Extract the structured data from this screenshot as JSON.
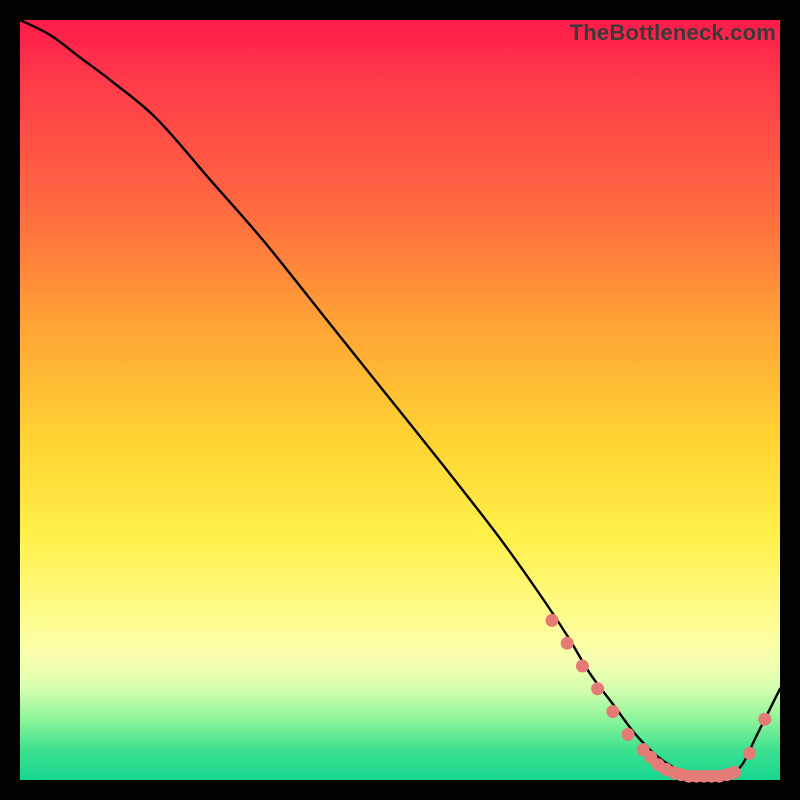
{
  "watermark": "TheBottleneck.com",
  "colors": {
    "curve": "#000000",
    "dot_fill": "#e47b76",
    "dot_stroke": "#c95a55"
  },
  "chart_data": {
    "type": "line",
    "title": "",
    "xlabel": "",
    "ylabel": "",
    "xlim": [
      0,
      100
    ],
    "ylim": [
      0,
      100
    ],
    "series": [
      {
        "name": "bottleneck-curve",
        "x": [
          0,
          4,
          8,
          12,
          18,
          25,
          32,
          40,
          48,
          56,
          63,
          68,
          72,
          75,
          78,
          81,
          84,
          87,
          90,
          93,
          95,
          97,
          100
        ],
        "y": [
          100,
          98,
          95,
          92,
          87,
          79,
          71,
          61,
          51,
          41,
          32,
          25,
          19,
          14,
          10,
          6,
          3,
          1.2,
          0.5,
          0.5,
          2,
          6,
          12
        ]
      }
    ],
    "dots": {
      "name": "highlight-dots",
      "x": [
        70,
        72,
        74,
        76,
        78,
        80,
        82,
        83,
        84,
        85,
        86,
        87,
        88,
        89,
        90,
        91,
        92,
        93,
        94,
        96,
        98
      ],
      "y": [
        21,
        18,
        15,
        12,
        9,
        6,
        4,
        3,
        2,
        1.4,
        1,
        0.7,
        0.5,
        0.5,
        0.5,
        0.5,
        0.5,
        0.7,
        1,
        3.5,
        8
      ]
    }
  }
}
